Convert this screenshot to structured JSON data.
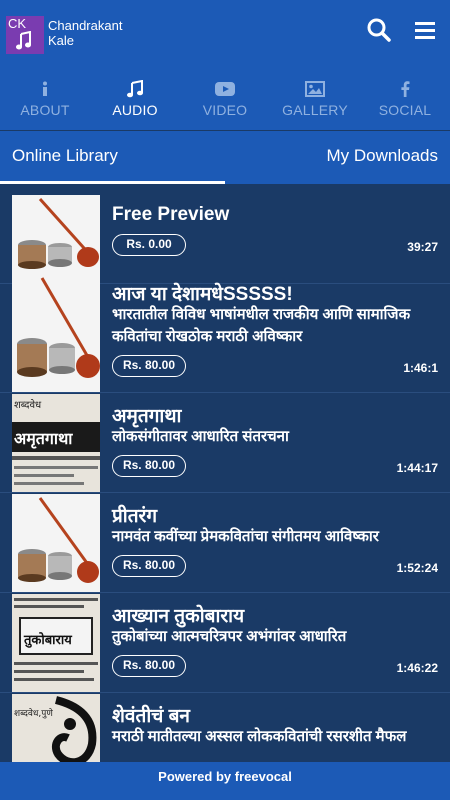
{
  "app": {
    "logo_text": "CK",
    "brand_line1": "Chandrakant",
    "brand_line2": "Kale"
  },
  "tabs": [
    {
      "label": "ABOUT",
      "icon": "info-icon",
      "active": false
    },
    {
      "label": "AUDIO",
      "icon": "music-note-icon",
      "active": true
    },
    {
      "label": "VIDEO",
      "icon": "play-video-icon",
      "active": false
    },
    {
      "label": "GALLERY",
      "icon": "image-icon",
      "active": false
    },
    {
      "label": "SOCIAL",
      "icon": "facebook-icon",
      "active": false
    }
  ],
  "subtabs": {
    "online": "Online Library",
    "downloads": "My Downloads",
    "selected": "online"
  },
  "items": [
    {
      "title": "Free Preview",
      "desc": "",
      "price": "Rs. 0.00",
      "duration": "39:27",
      "thumb": "tabla-tanpura"
    },
    {
      "title": "आज या देशामधेSSSSS!",
      "desc": "भारतातील विविध भाषांमधील राजकीय आणि सामाजिक कवितांचा रोखठोक मराठी अविष्कार",
      "price": "Rs. 80.00",
      "duration": "1:46:1",
      "thumb": "tabla-tanpura"
    },
    {
      "title": "अमृतगाथा",
      "desc": "लोकसंगीतावर आधारित संतरचना",
      "price": "Rs. 80.00",
      "duration": "1:44:17",
      "thumb": "amrutgatha-poster"
    },
    {
      "title": "प्रीतरंग",
      "desc": "नामवंत कवींच्या प्रेमकवितांचा संगीतमय आविष्कार",
      "price": "Rs. 80.00",
      "duration": "1:52:24",
      "thumb": "tabla-tanpura"
    },
    {
      "title": "आख्यान तुकोबाराय",
      "desc": "तुकोबांच्या आत्मचरित्रपर अभंगांवर आधारित",
      "price": "Rs. 80.00",
      "duration": "1:46:22",
      "thumb": "tukobaray-poster"
    },
    {
      "title": "शेवंतीचं बन",
      "desc": "मराठी मातीतल्या अस्सल लोककवितांची रसरशीत मैफल",
      "price": "",
      "duration": "",
      "thumb": "shevanti-poster"
    }
  ],
  "thumb_texts": {
    "amrutgatha": "अमृतगाथा",
    "shabdavedh": "शब्दवेध",
    "tukobaray": "तुकोबाराय",
    "shabdavedh_pune": "शब्दवेध,पुणे"
  },
  "footer": {
    "text": "Powered by freevocal"
  },
  "colors": {
    "primary": "#1c5ab6",
    "list_bg": "#1a3a66",
    "logo": "#7a3cb0",
    "inactive_tab": "#8fb1e0"
  }
}
